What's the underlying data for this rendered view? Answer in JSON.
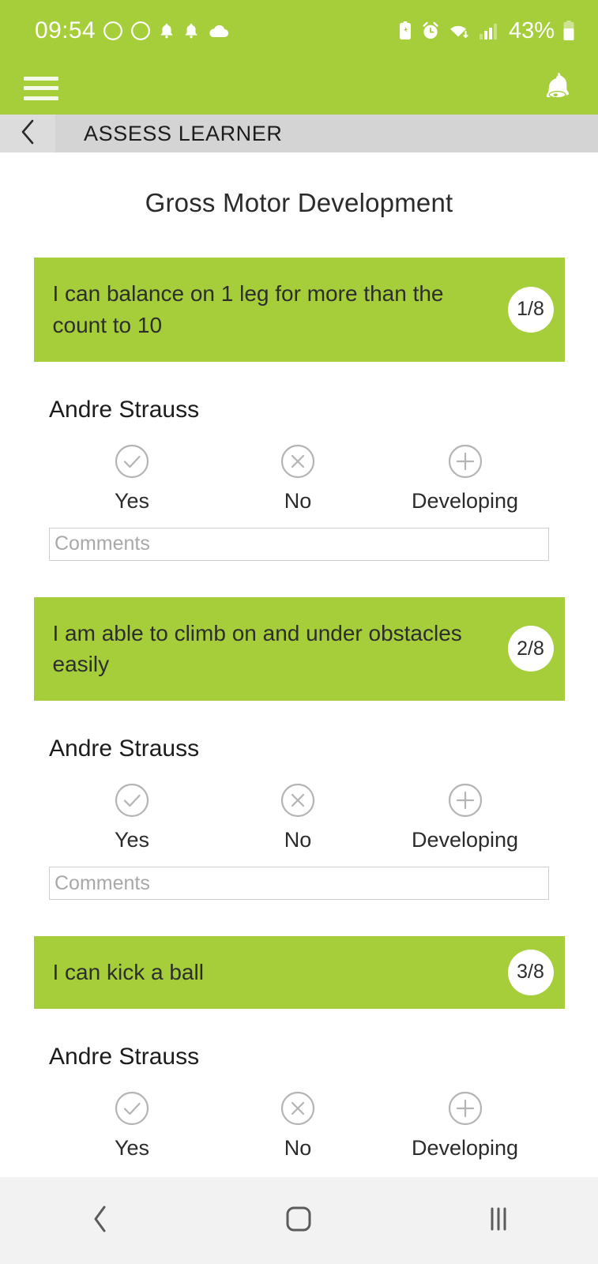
{
  "status_bar": {
    "time": "09:54",
    "battery_percent": "43%",
    "left_icons": [
      "dnd-icon",
      "dnd-icon",
      "bell-icon",
      "bell-icon",
      "cloud-icon"
    ],
    "right_icons": [
      "battery-saver-icon",
      "alarm-clock-icon",
      "wifi-icon",
      "signal-bars-icon",
      "battery-icon"
    ],
    "background_color": "#a5ce3a",
    "foreground_color": "#ffffff"
  },
  "app_bar": {
    "menu_icon": "hamburger-menu-icon",
    "notification_icon": "bell-icon",
    "background_color": "#a5ce3a"
  },
  "title_bar": {
    "back_icon": "chevron-left-icon",
    "title": "ASSESS LEARNER",
    "background_color": "#d4d4d4"
  },
  "page": {
    "title": "Gross Motor Development",
    "accent_color": "#a5ce3a",
    "total_questions": 8
  },
  "options": {
    "yes": {
      "label": "Yes",
      "icon": "check-circle-icon",
      "selected": false
    },
    "no": {
      "label": "No",
      "icon": "x-circle-icon",
      "selected": false
    },
    "developing": {
      "label": "Developing",
      "icon": "plus-circle-icon",
      "selected": false
    }
  },
  "comments": {
    "placeholder": "Comments",
    "value": ""
  },
  "questions": [
    {
      "text": "I can balance on 1 leg for more than the count to 10",
      "badge": "1/8",
      "learner": "Andre Strauss",
      "lines": 2
    },
    {
      "text": "I am able to climb on and under obstacles easily",
      "badge": "2/8",
      "learner": "Andre Strauss",
      "lines": 2
    },
    {
      "text": "I can kick a ball",
      "badge": "3/8",
      "learner": "Andre Strauss",
      "lines": 1
    }
  ],
  "nav_bar": {
    "back": "back-icon",
    "home": "home-icon",
    "recents": "recents-icon",
    "background_color": "#f2f2f2"
  }
}
